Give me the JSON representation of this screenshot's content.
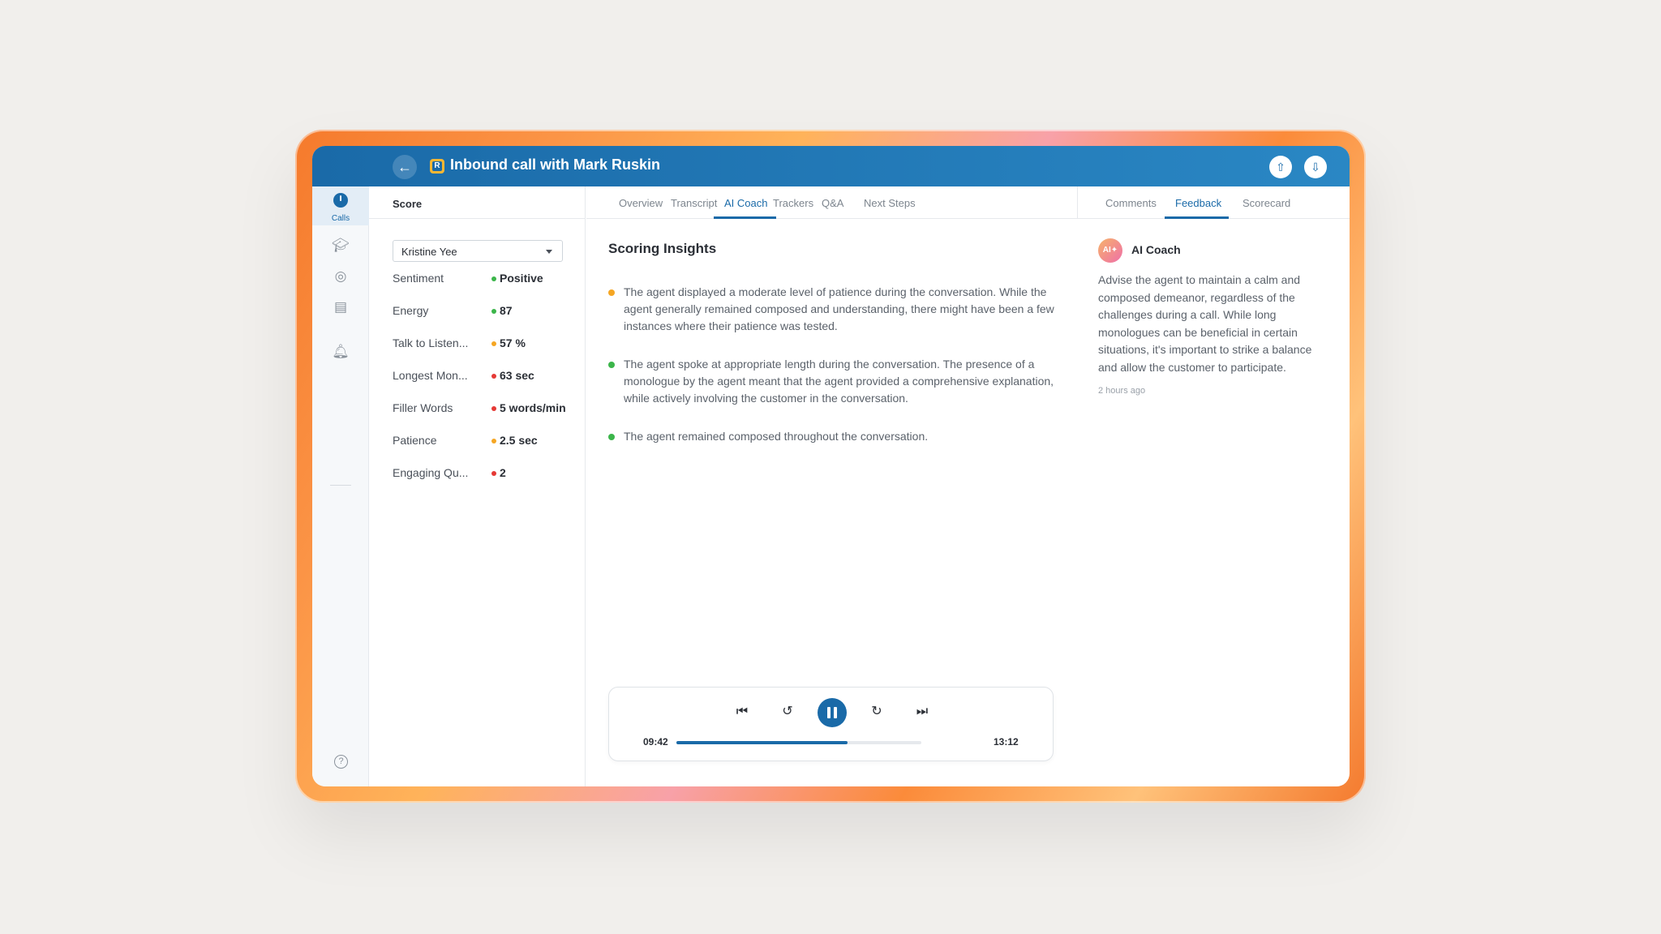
{
  "header": {
    "title": "Inbound call with Mark Ruskin",
    "logo_letter": "R"
  },
  "rail": {
    "calls_label": "Calls"
  },
  "score_panel": {
    "title": "Score",
    "agent": "Kristine Yee",
    "metrics": [
      {
        "label": "Sentiment",
        "value": "Positive",
        "color": "#3bb54a"
      },
      {
        "label": "Energy",
        "value": "87",
        "color": "#3bb54a"
      },
      {
        "label": "Talk to Listen...",
        "value": "57 %",
        "color": "#f5a623"
      },
      {
        "label": "Longest Mon...",
        "value": "63 sec",
        "color": "#e53935"
      },
      {
        "label": "Filler Words",
        "value": "5 words/min",
        "color": "#e53935"
      },
      {
        "label": "Patience",
        "value": "2.5 sec",
        "color": "#f5a623"
      },
      {
        "label": "Engaging Qu...",
        "value": "2",
        "color": "#e53935"
      }
    ]
  },
  "center": {
    "tabs": [
      "Overview",
      "Transcript",
      "AI Coach",
      "Trackers",
      "Q&A",
      "Next Steps"
    ],
    "active_tab": "AI Coach",
    "insights_title": "Scoring Insights",
    "insights": [
      {
        "text": "The agent displayed a moderate level of patience during the conversation. While the agent generally remained composed and understanding, there might have been a few instances where their patience was tested.",
        "color": "#f5a623"
      },
      {
        "text": "The agent spoke at appropriate length during the conversation. The presence of a monologue by the agent meant that the agent provided a comprehensive explanation, while actively involving the customer in the conversation.",
        "color": "#3bb54a"
      },
      {
        "text": "The agent remained composed throughout the conversation.",
        "color": "#3bb54a"
      }
    ]
  },
  "player": {
    "current_time": "09:42",
    "total_time": "13:12",
    "progress": 0.7
  },
  "right_panel": {
    "tabs": [
      "Comments",
      "Feedback",
      "Scorecard"
    ],
    "active_tab": "Feedback",
    "avatar_text": "AI✦",
    "coach_name": "AI Coach",
    "message": "Advise the agent to maintain a calm and composed demeanor, regardless of the challenges during a call. While long monologues can be beneficial in certain situations, it's important to strike a balance and allow the customer to participate.",
    "time_ago": "2 hours ago"
  },
  "colors": {
    "accent": "#1a6aa8",
    "positive": "#3bb54a",
    "warning": "#f5a623",
    "negative": "#e53935"
  }
}
